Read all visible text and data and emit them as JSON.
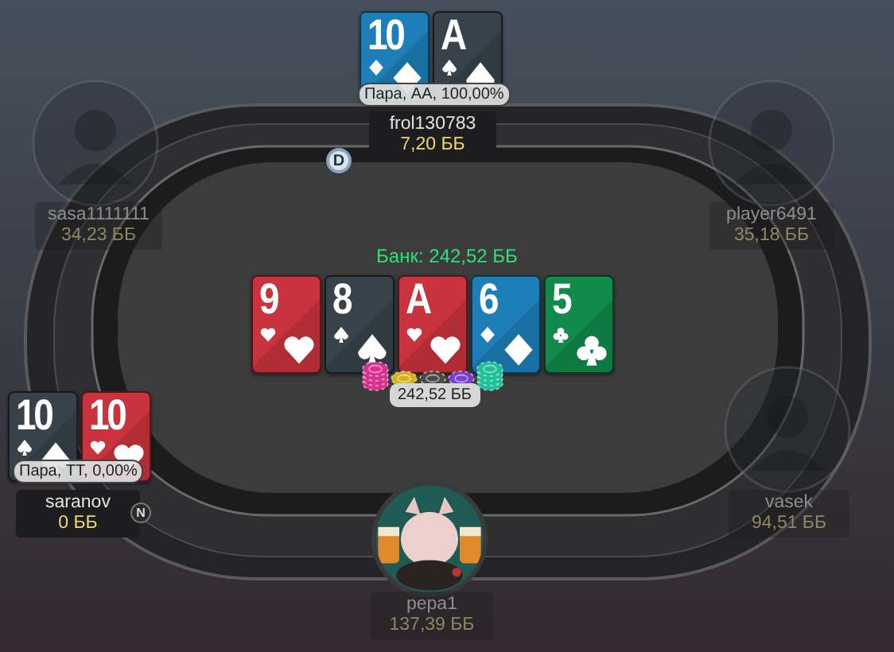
{
  "pot": {
    "label": "Банк: 242,52 ББ",
    "amount": "242,52 ББ",
    "chips": [
      {
        "color": "#d9318f"
      },
      {
        "color": "#d4b01c"
      },
      {
        "color": "#4a4a4a"
      },
      {
        "color": "#7b3fd0"
      },
      {
        "color": "#1fbf9a"
      }
    ]
  },
  "board": [
    {
      "rank": "9",
      "kind": "hearts"
    },
    {
      "rank": "8",
      "kind": "spades"
    },
    {
      "rank": "A",
      "kind": "hearts"
    },
    {
      "rank": "6",
      "kind": "diamonds"
    },
    {
      "rank": "5",
      "kind": "clubs"
    }
  ],
  "seats": [
    {
      "name": "frol130783",
      "stack": "7,20 ББ",
      "active": true,
      "cards": [
        {
          "rank": "10",
          "kind": "diamonds"
        },
        {
          "rank": "A",
          "kind": "spades"
        }
      ],
      "hand": "Пара, AA, 100,00%",
      "button": "D"
    },
    {
      "name": "sasa1111111",
      "stack": "34,23 ББ",
      "active": false,
      "avatar": {
        "kind": "placeholder"
      }
    },
    {
      "name": "player6491",
      "stack": "35,18 ББ",
      "active": false,
      "avatar": {
        "kind": "placeholder"
      }
    },
    {
      "name": "saranov",
      "stack": "0 ББ",
      "active": true,
      "cards": [
        {
          "rank": "10",
          "kind": "spades"
        },
        {
          "rank": "10",
          "kind": "hearts"
        }
      ],
      "hand": "Пара, TT, 0,00%",
      "button": "N"
    },
    {
      "name": "vasek",
      "stack": "94,51 ББ",
      "active": false,
      "avatar": {
        "kind": "placeholder"
      }
    },
    {
      "name": "pepa1",
      "stack": "137,39 ББ",
      "active": false
    }
  ]
}
